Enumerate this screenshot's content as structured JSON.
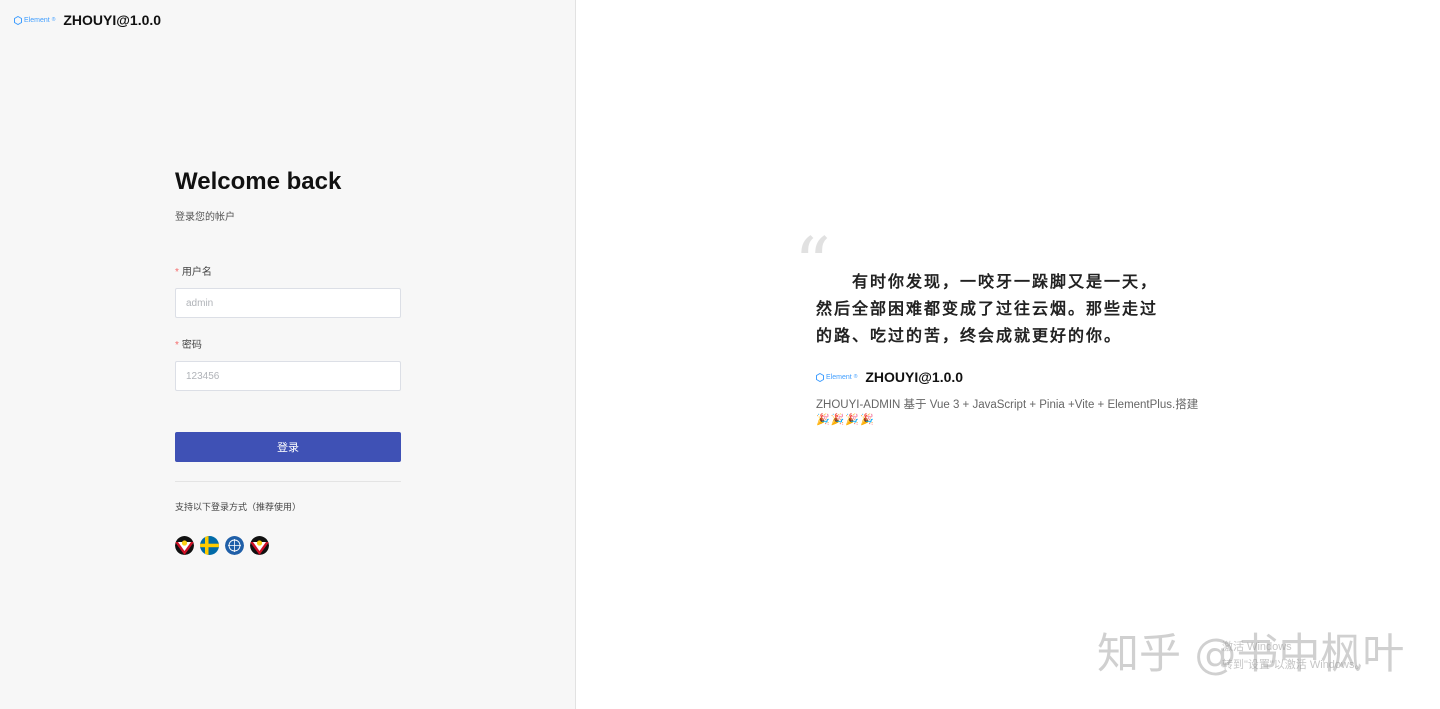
{
  "brand": {
    "logo_text": "Element",
    "title": "ZHOUYI@1.0.0"
  },
  "login": {
    "heading": "Welcome back",
    "subtitle": "登录您的帐户",
    "username_label": "用户名",
    "username_placeholder": "admin",
    "password_label": "密码",
    "password_placeholder": "123456",
    "required_mark": "*",
    "submit_label": "登录",
    "alt_text": "支持以下登录方式（推荐使用）",
    "socials": [
      "social-login-1",
      "social-login-2",
      "social-login-3",
      "social-login-4"
    ]
  },
  "promo": {
    "quote_mark": "“",
    "quote_lines": [
      "有时你发现，一咬牙一跺脚又是一天，",
      "然后全部困难都变成了过往云烟。那些走过",
      "的路、吃过的苦，终会成就更好的你。"
    ],
    "logo_text": "Element",
    "title": "ZHOUYI@1.0.0",
    "description": "ZHOUYI-ADMIN 基于 Vue 3 + JavaScript + Pinia +Vite + ElementPlus.搭建",
    "emojis": "🎉🎉🎉🎉"
  },
  "watermark": {
    "text": "知乎 @书中枫叶",
    "activate_line1": "激活 Windows",
    "activate_line2": "转到\"设置\"以激活 Windows。"
  },
  "colors": {
    "primary": "#3f51b5",
    "accent": "#409eff",
    "required": "#f56c6c"
  }
}
